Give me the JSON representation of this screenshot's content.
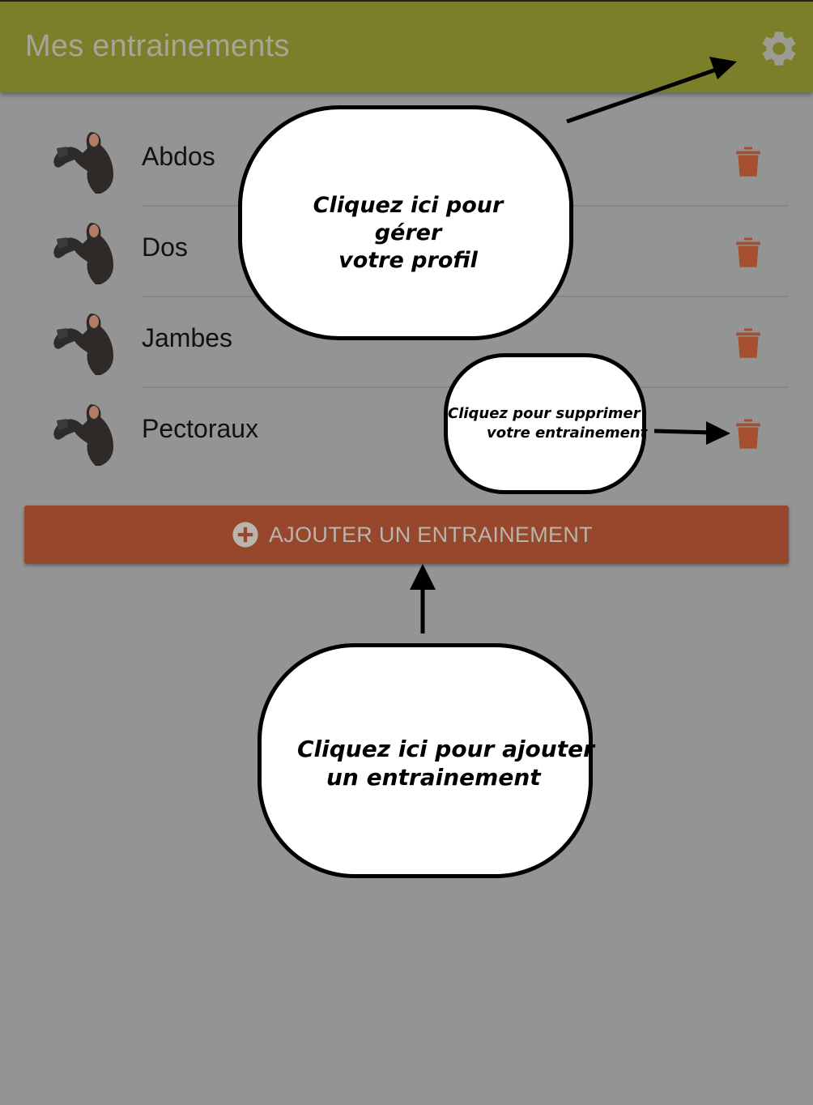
{
  "appbar": {
    "title": "Mes entrainements",
    "settings_icon": "gear-icon"
  },
  "workouts": [
    {
      "label": "Abdos"
    },
    {
      "label": "Dos"
    },
    {
      "label": "Jambes"
    },
    {
      "label": "Pectoraux"
    }
  ],
  "add_button": {
    "label": "AJOUTER UN ENTRAINEMENT",
    "icon": "plus-circle-icon"
  },
  "annotations": {
    "profile": {
      "line1": "Cliquez ici pour gérer",
      "line2": "votre profil"
    },
    "delete": {
      "line1": "Cliquez pour supprimer",
      "line2": "votre entrainement"
    },
    "add": {
      "line1": "Cliquez ici pour ajouter",
      "line2": "un entrainement"
    }
  },
  "colors": {
    "appbar": "#7b7f29",
    "background": "#949494",
    "accent": "#96472c",
    "trash": "#a4502f"
  }
}
